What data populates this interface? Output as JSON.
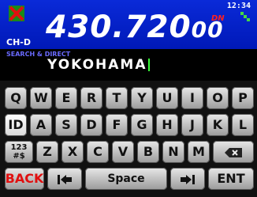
{
  "status": {
    "clock": "12:34",
    "frequency_main": "430.720",
    "frequency_small": "00",
    "dn_label": "DN",
    "channel_mode": "CH-D"
  },
  "search": {
    "label": "SEARCH & DIRECT",
    "value": "YOKOHAMA"
  },
  "keyboard": {
    "row1": [
      "Q",
      "W",
      "E",
      "R",
      "T",
      "Y",
      "U",
      "I",
      "O",
      "P"
    ],
    "row2_lead": "ID",
    "row2": [
      "A",
      "S",
      "D",
      "F",
      "G",
      "H",
      "J",
      "K",
      "L"
    ],
    "row3_lead": "123\n#$",
    "row3": [
      "Z",
      "X",
      "C",
      "V",
      "B",
      "N",
      "M"
    ],
    "backspace": "backspace-icon",
    "row4": {
      "back": "BACK",
      "prev": "cursor-left-icon",
      "space": "Space",
      "next": "cursor-right-icon",
      "ent": "ENT"
    }
  },
  "colors": {
    "top_bar": "#0a2ad8",
    "back_text": "#e01010",
    "caret": "#38ff38",
    "dn_text": "#ff2020"
  }
}
